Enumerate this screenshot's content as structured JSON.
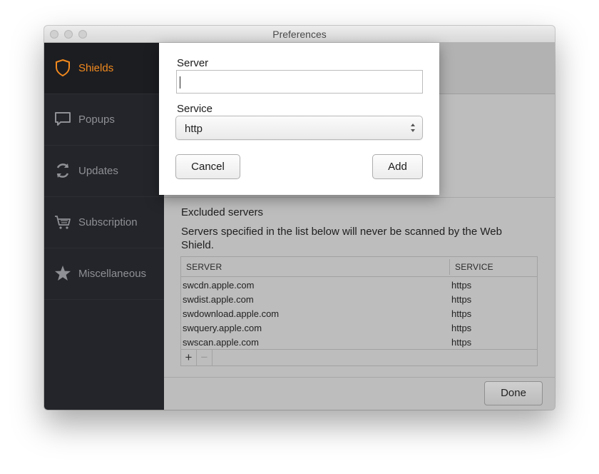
{
  "window": {
    "title": "Preferences"
  },
  "sidebar": {
    "items": [
      {
        "label": "Shields",
        "icon": "shield-icon",
        "active": true
      },
      {
        "label": "Popups",
        "icon": "speech-bubble-icon"
      },
      {
        "label": "Updates",
        "icon": "refresh-icon"
      },
      {
        "label": "Subscription",
        "icon": "cart-icon"
      },
      {
        "label": "Miscellaneous",
        "icon": "star-icon"
      }
    ]
  },
  "main": {
    "partial_text": ",",
    "excluded": {
      "title": "Excluded servers",
      "description": "Servers specified in the list below will never be scanned by the Web Shield."
    },
    "table": {
      "columns": [
        "SERVER",
        "SERVICE"
      ],
      "rows": [
        {
          "server": "swcdn.apple.com",
          "service": "https"
        },
        {
          "server": "swdist.apple.com",
          "service": "https"
        },
        {
          "server": "swdownload.apple.com",
          "service": "https"
        },
        {
          "server": "swquery.apple.com",
          "service": "https"
        },
        {
          "server": "swscan.apple.com",
          "service": "https"
        }
      ],
      "add_label": "+",
      "remove_label": "−"
    },
    "done_label": "Done"
  },
  "dialog": {
    "server_label": "Server",
    "server_value": "",
    "service_label": "Service",
    "service_value": "http",
    "cancel_label": "Cancel",
    "add_label": "Add"
  },
  "colors": {
    "accent": "#f28a1e",
    "sidebar_bg": "#23252a"
  }
}
